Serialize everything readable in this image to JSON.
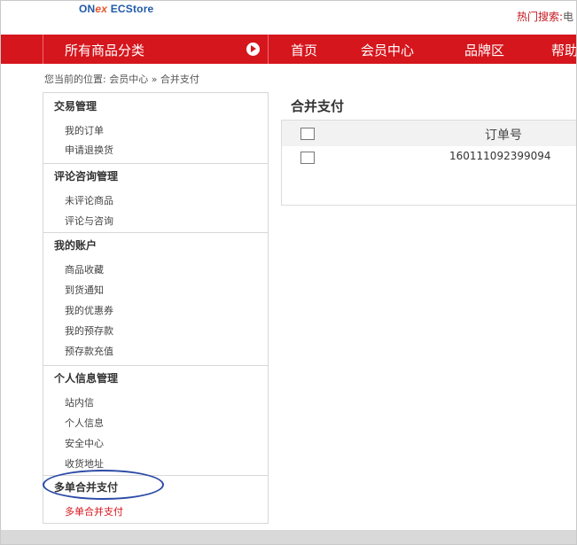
{
  "header": {
    "logo_on": "ON",
    "logo_ex": "ex",
    "logo_store": " ECStore",
    "hot_search_label": "热门搜索:",
    "hot_search_cut": "电"
  },
  "nav": {
    "category_label": "所有商品分类",
    "links": [
      "首页",
      "会员中心",
      "品牌区",
      "帮助"
    ]
  },
  "breadcrumb": "您当前的位置: 会员中心 » 合并支付",
  "sidebar": {
    "sections": [
      {
        "title": "交易管理",
        "items": [
          "我的订单",
          "申请退换货"
        ]
      },
      {
        "title": "评论咨询管理",
        "items": [
          "未评论商品",
          "评论与咨询"
        ]
      },
      {
        "title": "我的账户",
        "items": [
          "商品收藏",
          "到货通知",
          "我的优惠券",
          "我的预存款",
          "预存款充值"
        ]
      },
      {
        "title": "个人信息管理",
        "items": [
          "站内信",
          "个人信息",
          "安全中心",
          "收货地址"
        ]
      },
      {
        "title": "多单合并支付",
        "items": [
          "多单合并支付"
        ]
      }
    ]
  },
  "main": {
    "title": "合并支付",
    "table": {
      "header_order": "订单号",
      "rows": [
        {
          "order_no": "160111092399094"
        }
      ]
    }
  },
  "colors": {
    "brand_red": "#d5161d",
    "logo_blue": "#1f5aa6",
    "highlight_ellipse": "#2b4aa6"
  }
}
